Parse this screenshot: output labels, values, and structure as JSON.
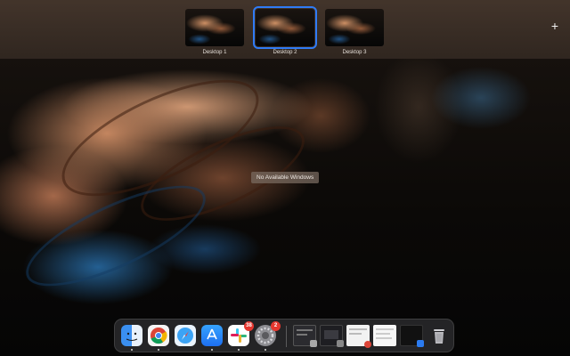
{
  "spaces": [
    {
      "label": "Desktop 1",
      "active": false
    },
    {
      "label": "Desktop 2",
      "active": true
    },
    {
      "label": "Desktop 3",
      "active": false
    }
  ],
  "add_space_icon": "plus-icon",
  "center_message": "No Available Windows",
  "accent_color": "#2f7bf5",
  "dock": {
    "apps": [
      {
        "name": "finder",
        "icon": "finder-icon"
      },
      {
        "name": "chrome",
        "icon": "chrome-icon"
      },
      {
        "name": "safari",
        "icon": "safari-icon"
      },
      {
        "name": "app-store",
        "icon": "app-store-icon"
      },
      {
        "name": "slack",
        "icon": "slack-icon",
        "badge": "38"
      },
      {
        "name": "system-preferences",
        "icon": "gear-icon",
        "badge": "2"
      }
    ],
    "minimized": [
      {
        "name": "minimized-window-1"
      },
      {
        "name": "minimized-window-2"
      },
      {
        "name": "minimized-window-3"
      },
      {
        "name": "minimized-window-4"
      },
      {
        "name": "minimized-window-5"
      }
    ],
    "trash_icon": "trash-icon"
  }
}
